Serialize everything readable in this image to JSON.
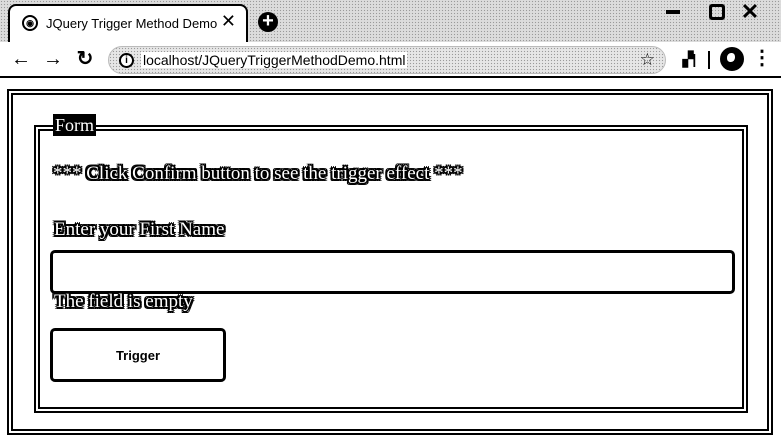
{
  "browser": {
    "tab": {
      "title": "JQuery Trigger Method Demo",
      "favicon": "globe-icon",
      "close_glyph": "✕"
    },
    "new_tab_glyph": "+",
    "window_controls": {
      "close_glyph": "✕"
    },
    "nav": {
      "back_glyph": "←",
      "forward_glyph": "→",
      "reload_glyph": "↻"
    },
    "address_bar": {
      "url": "localhost/JQueryTriggerMethodDemo.html",
      "info_glyph": "i",
      "star_glyph": "☆"
    },
    "toolbar_icons": {
      "extension_glyph": "▞|",
      "menu_glyph": "⋮"
    }
  },
  "page": {
    "form": {
      "legend": "Form",
      "instruction": "*** Click Confirm button to see the trigger effect ***",
      "first_name_label": "Enter your First Name",
      "first_name_value": "",
      "status_text": "The field is empty",
      "trigger_button_label": "Trigger"
    }
  }
}
